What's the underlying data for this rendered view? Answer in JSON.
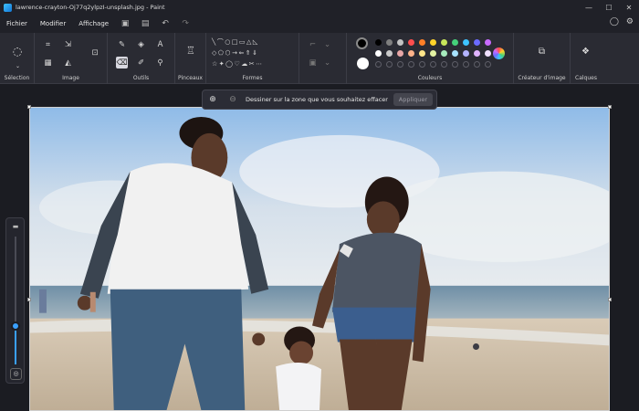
{
  "window": {
    "title": "lawrence-crayton-Oj77q2ylpzI-unsplash.jpg - Paint",
    "controls": {
      "minimize": "—",
      "maximize": "☐",
      "close": "✕"
    }
  },
  "menu": {
    "file": "Fichier",
    "edit": "Modifier",
    "view": "Affichage",
    "save_icon": "💾",
    "undo": "↶",
    "redo": "↷",
    "account": "👤",
    "settings": "⚙"
  },
  "ribbon": {
    "groups": {
      "selection": "Sélection",
      "image": "Image",
      "tools": "Outils",
      "brush": "Pinceaux",
      "shapes": "Formes",
      "colors": "Couleurs",
      "image_creator": "Créateur d'image",
      "layers": "Calques"
    },
    "colors": {
      "primary": "#000000",
      "secondary": "#ffffff",
      "palette_row1": [
        "#000000",
        "#7f7f7f",
        "#c3c3c3",
        "#ff4e4e",
        "#ff7f27",
        "#ffd32a",
        "#c8e65a",
        "#45d17a",
        "#3ec3ff",
        "#6b6bff",
        "#c86bff"
      ],
      "palette_row2": [
        "#ffffff",
        "#c9c9c9",
        "#e8a7a7",
        "#ffb38a",
        "#ffe58a",
        "#e3f2a2",
        "#a6ebbd",
        "#a8e3ff",
        "#b3b3ff",
        "#e0b3ff",
        "#f0e0ff"
      ]
    }
  },
  "prompt": {
    "text": "Dessiner sur la zone que vous souhaitez effacer",
    "apply": "Appliquer",
    "add_icon": "⊕",
    "remove_icon": "⊖"
  },
  "brush_size": {
    "value": 0.3
  }
}
